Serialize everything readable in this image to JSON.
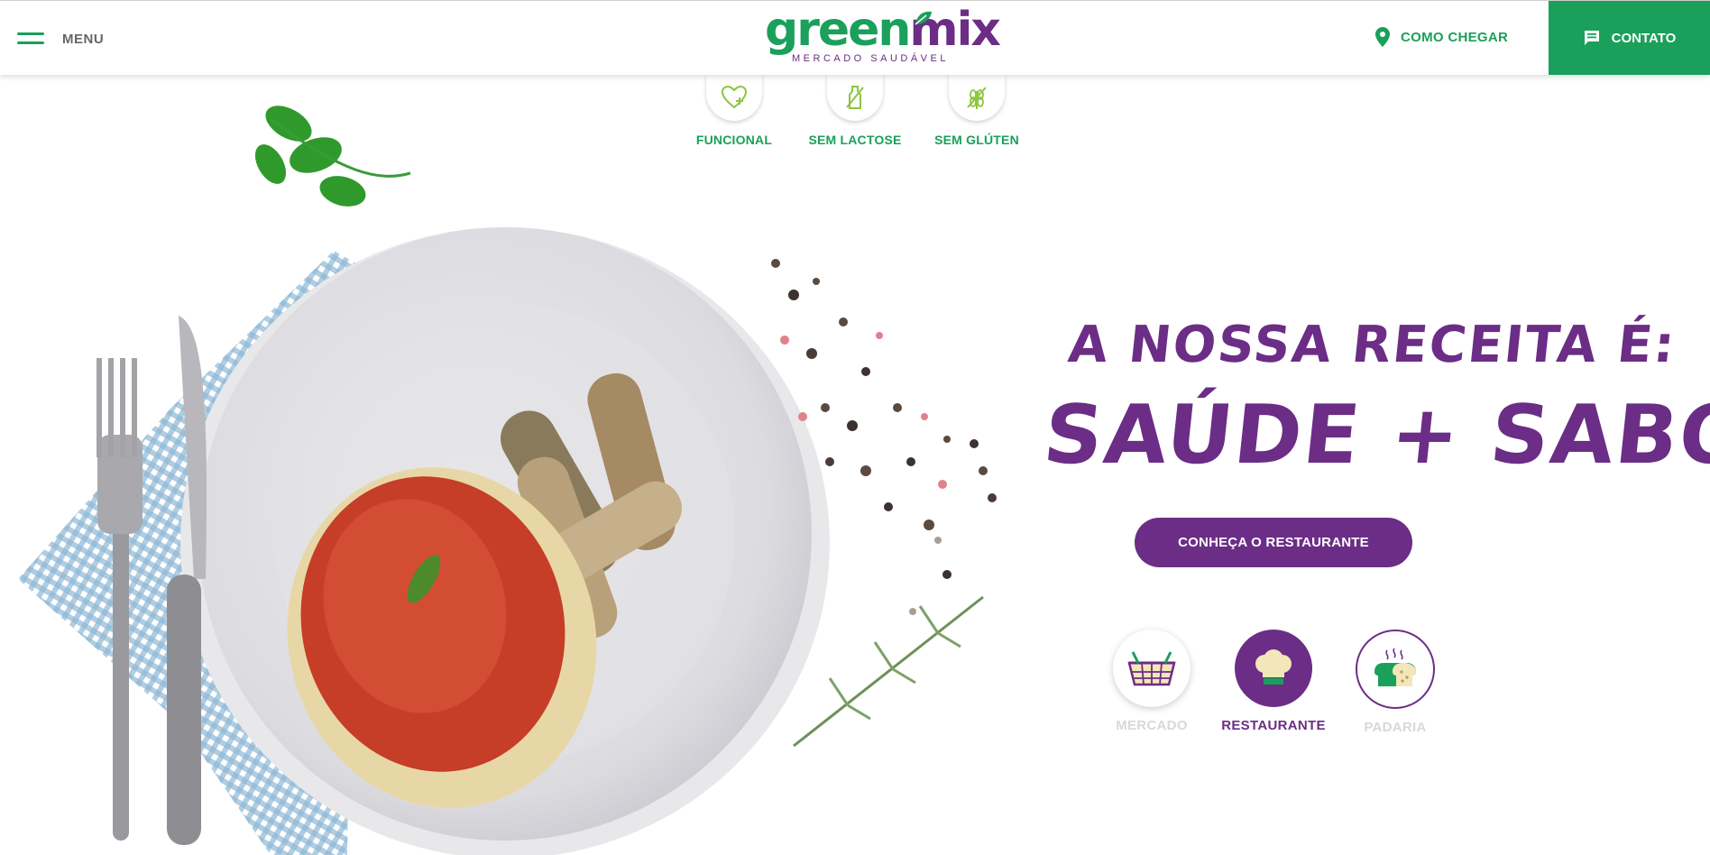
{
  "header": {
    "menu_label": "MENU",
    "logo": {
      "part1": "green",
      "part2": "mix",
      "subtitle": "MERCADO SAUDÁVEL"
    },
    "como_chegar": "COMO CHEGAR",
    "contato": "CONTATO",
    "colors": {
      "green": "#1aa05a",
      "purple": "#6b2d86"
    }
  },
  "diet_tabs": [
    {
      "label": "FUNCIONAL",
      "icon": "heart-plus-icon"
    },
    {
      "label": "SEM LACTOSE",
      "icon": "no-milk-bottle-icon"
    },
    {
      "label": "SEM GLÚTEN",
      "icon": "no-wheat-icon"
    }
  ],
  "hero": {
    "headline_line1": "A NOSSA RECEITA É:",
    "headline_line2": "SAÚDE + SABOR",
    "cta": "CONHEÇA O RESTAURANTE"
  },
  "sections": [
    {
      "label": "MERCADO",
      "icon": "basket-icon",
      "active": false
    },
    {
      "label": "RESTAURANTE",
      "icon": "chef-hat-icon",
      "active": true
    },
    {
      "label": "PADARIA",
      "icon": "bread-icon",
      "active": false
    }
  ]
}
